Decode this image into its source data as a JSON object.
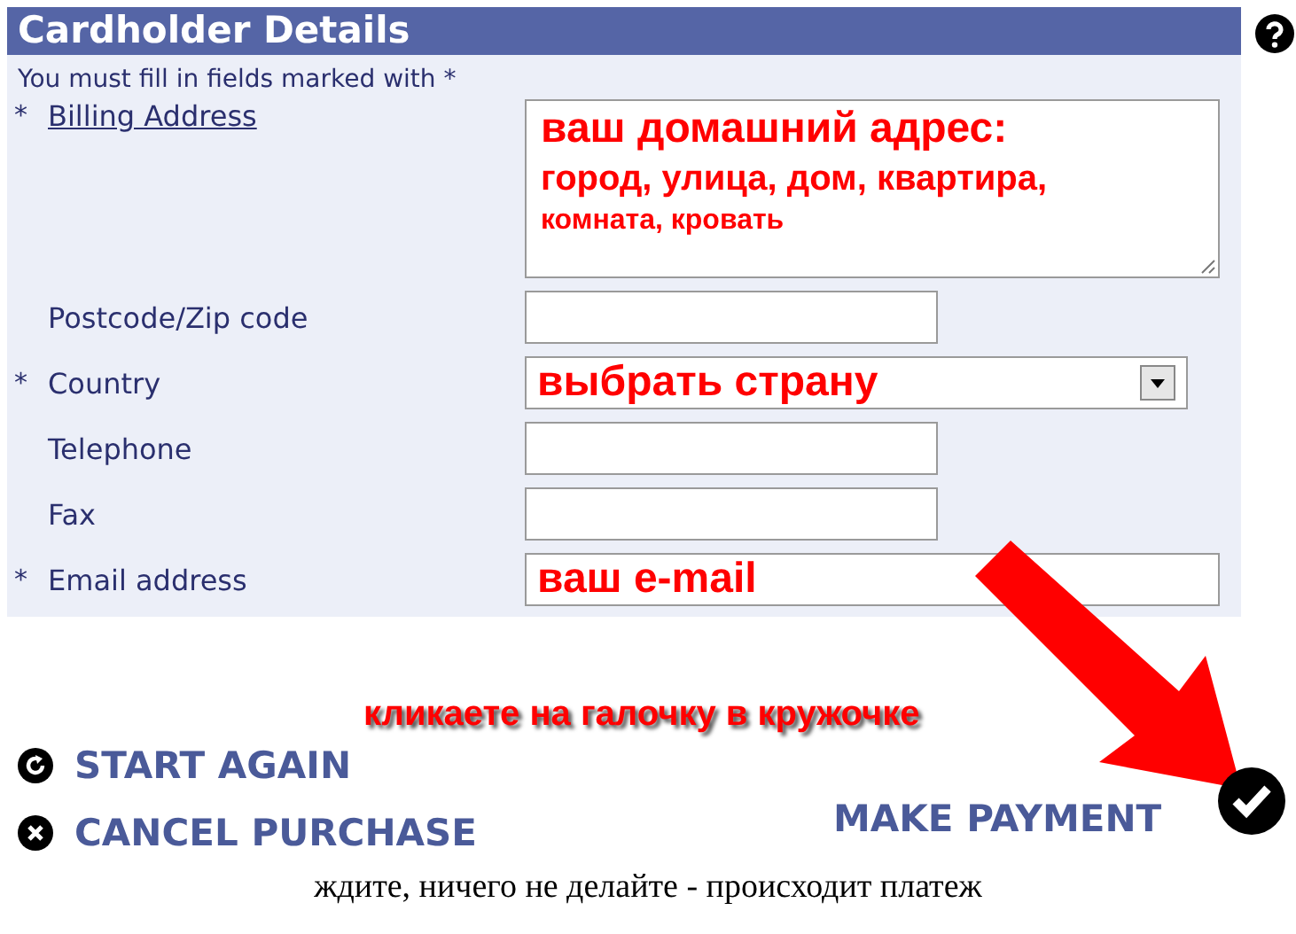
{
  "panel": {
    "title": "Cardholder Details",
    "note": "You must fill in fields marked with *"
  },
  "fields": [
    {
      "kind": "textarea",
      "label": "Billing Address",
      "marker": "*",
      "link": true,
      "lines": [
        "ваш домашний адрес:",
        "город, улица, дом, квартира,",
        "комната, кровать"
      ]
    },
    {
      "kind": "text",
      "label": "Postcode/Zip code",
      "link": false
    },
    {
      "kind": "select",
      "label": "Country",
      "marker": "*",
      "link": false,
      "lines": [
        "выбрать страну"
      ]
    },
    {
      "kind": "text",
      "label": "Telephone",
      "link": false
    },
    {
      "kind": "text",
      "label": "Fax",
      "link": false
    },
    {
      "kind": "text",
      "label": "Email address",
      "marker": "*",
      "link": false,
      "lines": [
        "ваш e-mail"
      ]
    }
  ],
  "hint": "кликаете на галочку в кружочке",
  "actions": [
    {
      "kind": "restart",
      "label": "START AGAIN"
    },
    {
      "kind": "cancel",
      "label": "CANCEL PURCHASE"
    }
  ],
  "submit": {
    "label": "MAKE PAYMENT"
  },
  "caption": "ждите, ничего не делайте - происходит платеж"
}
